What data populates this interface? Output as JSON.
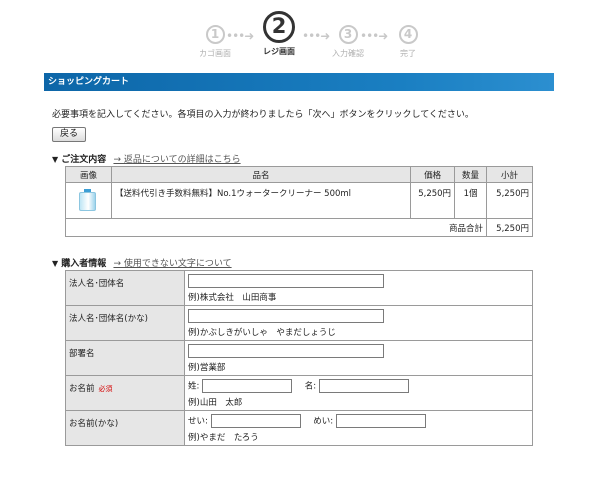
{
  "steps": [
    {
      "num": "1",
      "label": "カゴ画面",
      "active": false
    },
    {
      "num": "2",
      "label": "レジ画面",
      "active": true
    },
    {
      "num": "3",
      "label": "入力確認",
      "active": false
    },
    {
      "num": "4",
      "label": "完了",
      "active": false
    }
  ],
  "arrow_glyph": "•••➜",
  "header": {
    "title": "ショッピングカート"
  },
  "instructions": "必要事項を記入してください。各項目の入力が終わりましたら「次へ」ボタンをクリックしてください。",
  "back_button": "戻る",
  "order_section": {
    "triangle": "▼",
    "title": "ご注文内容",
    "link": "→ 返品についての詳細はこちら",
    "headers": {
      "image": "画像",
      "name": "品名",
      "price": "価格",
      "qty": "数量",
      "subtotal": "小計"
    },
    "item": {
      "name": "【送料代引き手数料無料】No.1ウォータークリーナー 500ml",
      "price": "5,250円",
      "qty": "1個",
      "subtotal": "5,250円"
    },
    "total_label": "商品合計",
    "total_value": "5,250円"
  },
  "buyer_section": {
    "triangle": "▼",
    "title": "購入者情報",
    "link": "→ 使用できない文字について",
    "rows": [
      {
        "label": "法人名･団体名",
        "example": "例)株式会社　山田商事"
      },
      {
        "label": "法人名･団体名(かな)",
        "example": "例)かぶしきがいしゃ　やまだしょうじ"
      },
      {
        "label": "部署名",
        "example": "例)営業部"
      },
      {
        "label": "お名前",
        "required": "必須",
        "first_label": "姓:",
        "second_label": "名:",
        "example": "例)山田　太郎"
      },
      {
        "label": "お名前(かな)",
        "first_label": "せい:",
        "second_label": "めい:",
        "example": "例)やまだ　たろう"
      }
    ]
  },
  "colors": {
    "accent_bar": "#1a7fc2",
    "required": "#d40000",
    "label_bg": "#e6e6e6"
  }
}
